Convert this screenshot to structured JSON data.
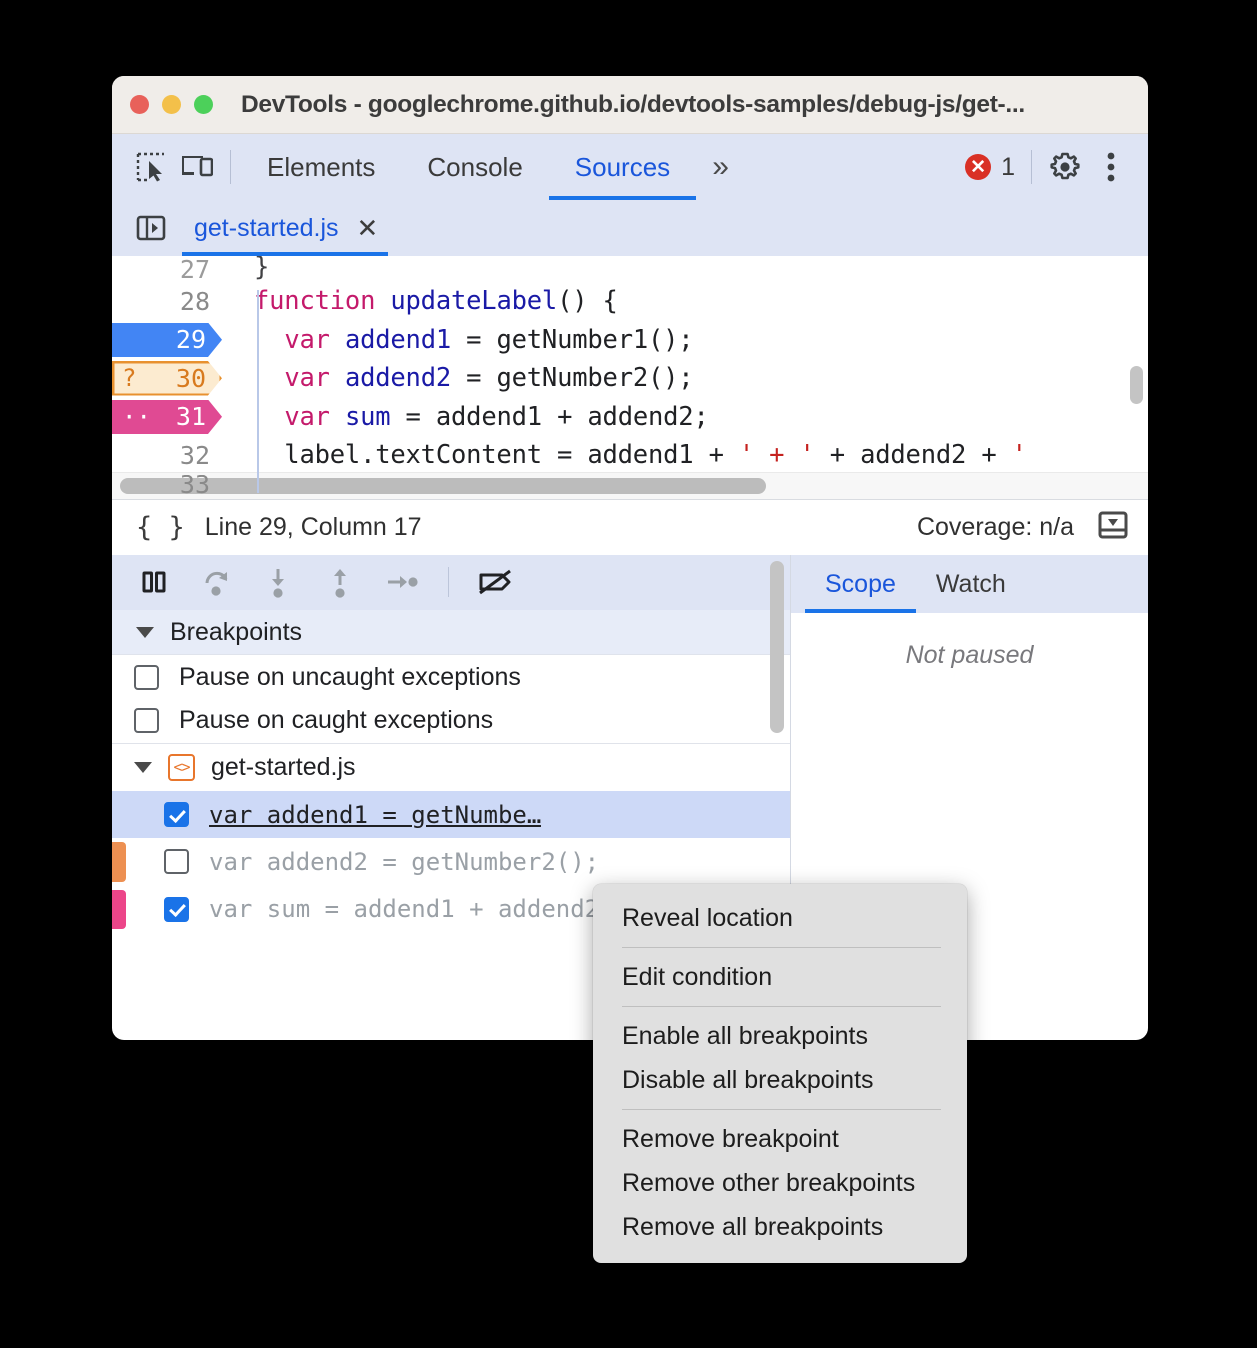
{
  "window": {
    "title": "DevTools - googlechrome.github.io/devtools-samples/debug-js/get-...",
    "traffic_lights": [
      "close",
      "minimize",
      "maximize"
    ],
    "colors": {
      "red": "#e8615a",
      "yellow": "#f3c04a",
      "green": "#4cd05a"
    }
  },
  "toolbar": {
    "inspect_icon": "inspect-element-icon",
    "device_icon": "device-toolbar-icon",
    "tabs": [
      {
        "label": "Elements",
        "active": false
      },
      {
        "label": "Console",
        "active": false
      },
      {
        "label": "Sources",
        "active": true
      }
    ],
    "more_tabs": "»",
    "error_count": "1",
    "error_glyph": "✕",
    "settings_icon": "gear-icon",
    "menu_icon": "kebab-menu-icon",
    "accent": "#1a73e8"
  },
  "file_tabs": {
    "navigator_toggle_icon": "show-navigator-icon",
    "open_file": "get-started.js",
    "close_glyph": "✕"
  },
  "editor": {
    "partial_top_line": "27",
    "partial_top_code": "}",
    "partial_bottom_line": "33",
    "partial_bottom_code": "}",
    "lines": [
      {
        "number": "28",
        "breakpoint": "none",
        "marker": "",
        "tokens": [
          {
            "t": "function ",
            "c": "kw"
          },
          {
            "t": "updateLabel",
            "c": "fn"
          },
          {
            "t": "() {",
            "c": "plain"
          }
        ]
      },
      {
        "number": "29",
        "breakpoint": "blue",
        "marker": "",
        "tokens": [
          {
            "t": "  ",
            "c": "plain"
          },
          {
            "t": "var",
            "c": "kw"
          },
          {
            "t": " ",
            "c": "plain"
          },
          {
            "t": "addend1",
            "c": "fn"
          },
          {
            "t": " = getNumber1();",
            "c": "plain"
          }
        ]
      },
      {
        "number": "30",
        "breakpoint": "orange",
        "marker": "?",
        "tokens": [
          {
            "t": "  ",
            "c": "plain"
          },
          {
            "t": "var",
            "c": "kw"
          },
          {
            "t": " ",
            "c": "plain"
          },
          {
            "t": "addend2",
            "c": "fn"
          },
          {
            "t": " = getNumber2();",
            "c": "plain"
          }
        ]
      },
      {
        "number": "31",
        "breakpoint": "pink",
        "marker": "··",
        "tokens": [
          {
            "t": "  ",
            "c": "plain"
          },
          {
            "t": "var",
            "c": "kw"
          },
          {
            "t": " ",
            "c": "plain"
          },
          {
            "t": "sum",
            "c": "fn"
          },
          {
            "t": " = addend1 + addend2;",
            "c": "plain"
          }
        ]
      },
      {
        "number": "32",
        "breakpoint": "none",
        "marker": "",
        "tokens": [
          {
            "t": "  label.textContent = addend1 + ",
            "c": "plain"
          },
          {
            "t": "' + '",
            "c": "str"
          },
          {
            "t": " + addend2 + ",
            "c": "plain"
          },
          {
            "t": "'",
            "c": "str"
          }
        ]
      }
    ]
  },
  "status_bar": {
    "braces_icon": "pretty-print-icon",
    "position": "Line 29, Column 17",
    "coverage": "Coverage: n/a",
    "drawer_icon": "show-drawer-icon"
  },
  "debugger_toolbar": {
    "buttons": [
      {
        "name": "pause-script-execution",
        "icon": "pause-icon",
        "active": true
      },
      {
        "name": "step-over-next-function-call",
        "icon": "step-over-icon",
        "active": false
      },
      {
        "name": "step-into-next-function-call",
        "icon": "step-into-icon",
        "active": false
      },
      {
        "name": "step-out-of-current-function",
        "icon": "step-out-icon",
        "active": false
      },
      {
        "name": "step",
        "icon": "step-icon",
        "active": false
      },
      {
        "name": "deactivate-breakpoints",
        "icon": "deactivate-breakpoints-icon",
        "active": true
      }
    ]
  },
  "breakpoints_panel": {
    "section_title": "Breakpoints",
    "expanded": true,
    "exception_options": [
      {
        "label": "Pause on uncaught exceptions",
        "checked": false
      },
      {
        "label": "Pause on caught exceptions",
        "checked": false
      }
    ],
    "file_group": {
      "expanded": true,
      "file_icon": "js-file-icon",
      "file_name": "get-started.js",
      "items": [
        {
          "text": "var addend1 = getNumbe…",
          "checked": true,
          "selected": true,
          "edge_color": "none"
        },
        {
          "text": "var addend2 = getNumber2();",
          "checked": false,
          "selected": false,
          "edge_color": "#ed9052"
        },
        {
          "text": "var sum = addend1 + addend2;",
          "checked": true,
          "selected": false,
          "edge_color": "#ec4589"
        }
      ]
    }
  },
  "side_panel": {
    "tabs": [
      {
        "label": "Scope",
        "active": true
      },
      {
        "label": "Watch",
        "active": false
      }
    ],
    "empty_message": "Not paused"
  },
  "context_menu": {
    "groups": [
      [
        "Reveal location"
      ],
      [
        "Edit condition"
      ],
      [
        "Enable all breakpoints",
        "Disable all breakpoints"
      ],
      [
        "Remove breakpoint",
        "Remove other breakpoints",
        "Remove all breakpoints"
      ]
    ]
  }
}
